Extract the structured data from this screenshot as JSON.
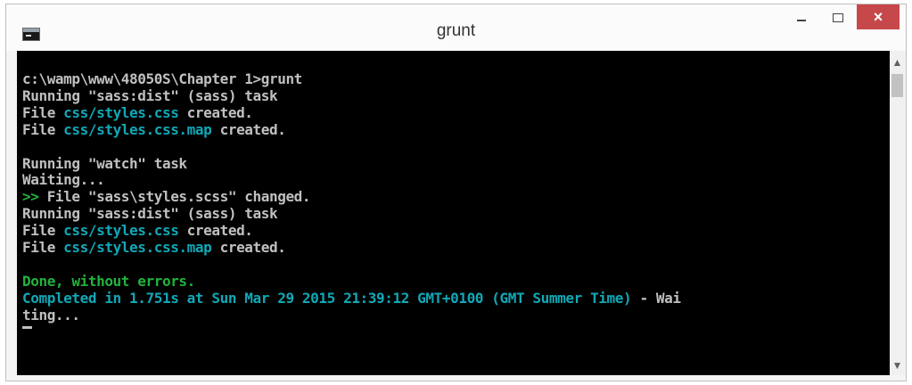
{
  "window": {
    "title": "grunt",
    "close_glyph": "×"
  },
  "console": {
    "lines": [
      [
        {
          "text": "c:\\wamp\\www\\48050S\\Chapter 1>grunt"
        }
      ],
      [
        {
          "text": "Running \"sass:dist\" (sass) task"
        }
      ],
      [
        {
          "text": "File "
        },
        {
          "text": "css/styles.css",
          "color": "cyan"
        },
        {
          "text": " created."
        }
      ],
      [
        {
          "text": "File "
        },
        {
          "text": "css/styles.css.map",
          "color": "cyan"
        },
        {
          "text": " created."
        }
      ],
      [],
      [
        {
          "text": "Running \"watch\" task"
        }
      ],
      [
        {
          "text": "Waiting..."
        }
      ],
      [
        {
          "text": ">>",
          "color": "green"
        },
        {
          "text": " File \"sass\\styles.scss\" changed."
        }
      ],
      [
        {
          "text": "Running \"sass:dist\" (sass) task"
        }
      ],
      [
        {
          "text": "File "
        },
        {
          "text": "css/styles.css",
          "color": "cyan"
        },
        {
          "text": " created."
        }
      ],
      [
        {
          "text": "File "
        },
        {
          "text": "css/styles.css.map",
          "color": "cyan"
        },
        {
          "text": " created."
        }
      ],
      [],
      [
        {
          "text": "Done, without errors.",
          "color": "green"
        }
      ],
      [
        {
          "text": "Completed in 1.751s at Sun Mar 29 2015 21:39:12 GMT+0100 (GMT Summer Time)",
          "color": "cyan"
        },
        {
          "text": " - Wai"
        }
      ],
      [
        {
          "text": "ting..."
        }
      ]
    ]
  },
  "colors": {
    "console_bg": "#000000",
    "text": "#c0c0c0",
    "cyan": "#11a8b7",
    "green": "#22b33b",
    "close_button": "#c7484a"
  },
  "icons": {
    "app": "console-icon",
    "minimize": "minimize-icon",
    "maximize": "maximize-icon",
    "close": "close-icon",
    "scroll_up": "scroll-up-arrow-icon",
    "scroll_down": "scroll-down-arrow-icon"
  }
}
